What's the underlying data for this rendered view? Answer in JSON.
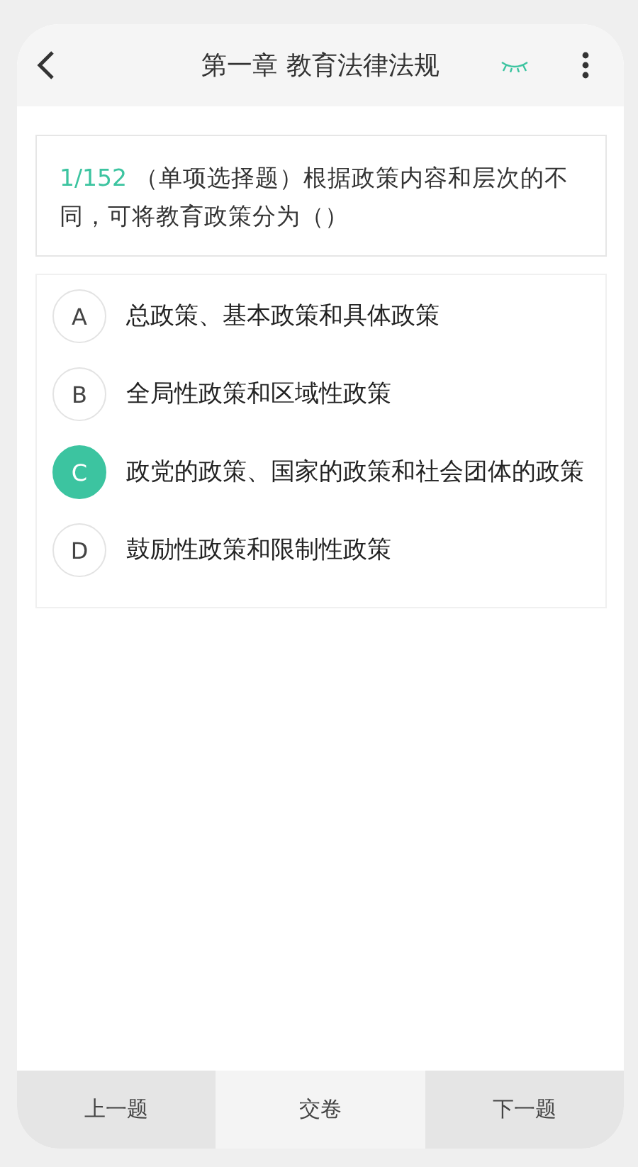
{
  "header": {
    "title": "第一章 教育法律法规"
  },
  "question": {
    "number": "1/152",
    "text": "（单项选择题）根据政策内容和层次的不同，可将教育政策分为（）"
  },
  "options": [
    {
      "letter": "A",
      "text": "总政策、基本政策和具体政策",
      "selected": false
    },
    {
      "letter": "B",
      "text": "全局性政策和区域性政策",
      "selected": false
    },
    {
      "letter": "C",
      "text": "政党的政策、国家的政策和社会团体的政策",
      "selected": true
    },
    {
      "letter": "D",
      "text": "鼓励性政策和限制性政策",
      "selected": false
    }
  ],
  "footer": [
    {
      "label": "上一题",
      "kind": "nav"
    },
    {
      "label": "交卷",
      "kind": "submit"
    },
    {
      "label": "下一题",
      "kind": "nav"
    }
  ]
}
